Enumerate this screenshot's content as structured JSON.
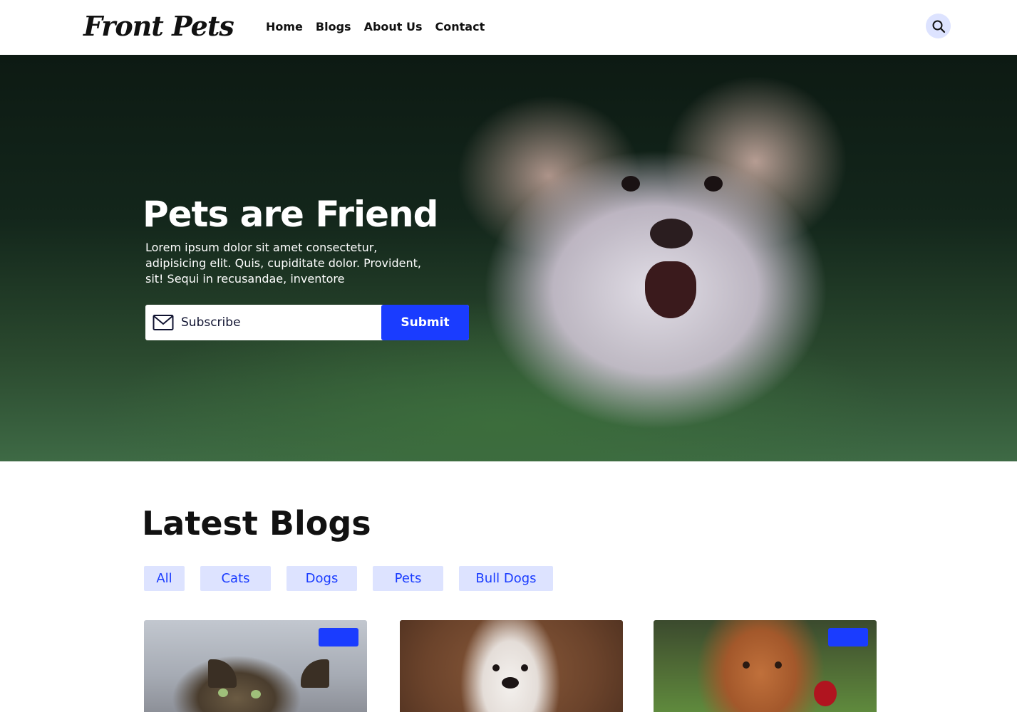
{
  "header": {
    "logo": "Front Pets",
    "nav": [
      {
        "label": "Home"
      },
      {
        "label": "Blogs"
      },
      {
        "label": "About Us"
      },
      {
        "label": "Contact"
      }
    ],
    "search_icon": "search-icon"
  },
  "hero": {
    "title": "Pets are Friend",
    "text": "Lorem ipsum dolor sit amet consectetur, adipisicing elit. Quis, cupiditate dolor. Provident, sit! Sequi in recusandae, inventore",
    "subscribe": {
      "icon": "mail-icon",
      "placeholder": "Subscribe",
      "button_label": "Submit"
    }
  },
  "blogs": {
    "title": "Latest Blogs",
    "filters": [
      "All",
      "Cats",
      "Dogs",
      "Pets",
      "Bull Dogs"
    ]
  },
  "colors": {
    "accent": "#1a3cff",
    "chip_bg": "#dde3ff",
    "search_bg": "#dde3ff"
  }
}
